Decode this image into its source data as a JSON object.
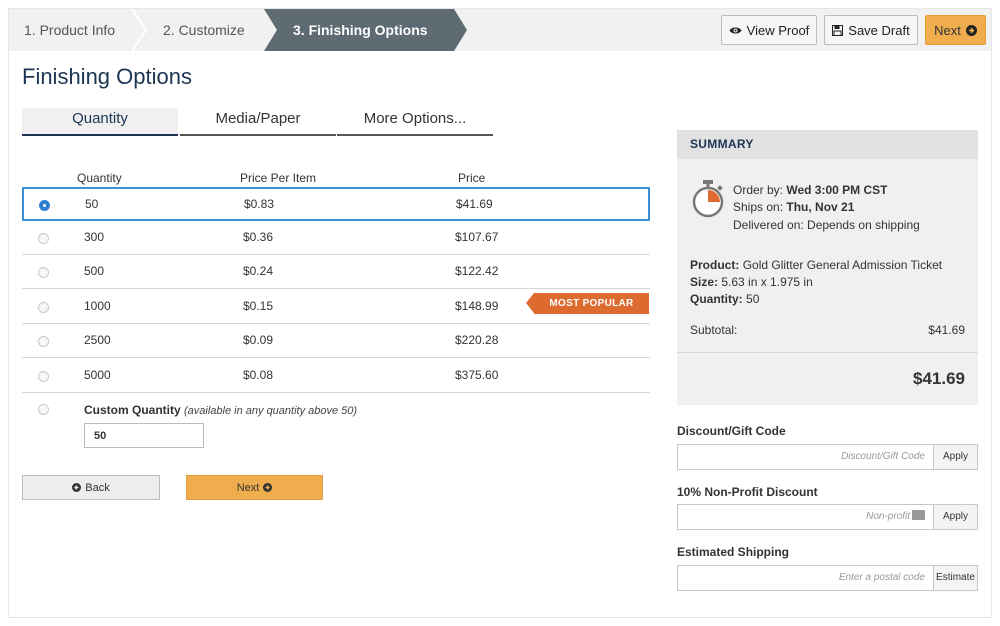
{
  "steps": [
    {
      "label": "1. Product Info"
    },
    {
      "label": "2. Customize"
    },
    {
      "label": "3. Finishing Options"
    }
  ],
  "toolbar": {
    "view_proof": "View Proof",
    "save_draft": "Save Draft",
    "next": "Next"
  },
  "page_title": "Finishing Options",
  "tabs": [
    {
      "label": "Quantity",
      "active": true
    },
    {
      "label": "Media/Paper",
      "active": false
    },
    {
      "label": "More Options...",
      "active": false
    }
  ],
  "table": {
    "headers": {
      "qty": "Quantity",
      "ppi": "Price Per Item",
      "price": "Price"
    },
    "rows": [
      {
        "qty": "50",
        "ppi": "$0.83",
        "price": "$41.69",
        "selected": true
      },
      {
        "qty": "300",
        "ppi": "$0.36",
        "price": "$107.67"
      },
      {
        "qty": "500",
        "ppi": "$0.24",
        "price": "$122.42"
      },
      {
        "qty": "1000",
        "ppi": "$0.15",
        "price": "$148.99",
        "badge": "MOST POPULAR"
      },
      {
        "qty": "2500",
        "ppi": "$0.09",
        "price": "$220.28"
      },
      {
        "qty": "5000",
        "ppi": "$0.08",
        "price": "$375.60"
      }
    ]
  },
  "custom_quantity": {
    "label": "Custom Quantity",
    "note": "(available in any quantity above 50)",
    "value": "50"
  },
  "buttons": {
    "back": "Back",
    "next": "Next"
  },
  "summary": {
    "heading": "SUMMARY",
    "order_by_label": "Order by: ",
    "order_by": "Wed 3:00 PM CST",
    "ships_on_label": "Ships on: ",
    "ships_on": "Thu, Nov 21",
    "delivered_on": "Delivered on: Depends on shipping",
    "product_label": "Product:",
    "product": "Gold Glitter General Admission Ticket",
    "size_label": "Size:",
    "size": "5.63 in x 1.975 in",
    "quantity_label": "Quantity:",
    "quantity": "50",
    "subtotal_label": "Subtotal:",
    "subtotal": "$41.69",
    "total": "$41.69"
  },
  "discount": {
    "label": "Discount/Gift Code",
    "placeholder": "Discount/Gift Code",
    "button": "Apply"
  },
  "nonprofit": {
    "label": "10% Non-Profit Discount",
    "placeholder": "Non-profit",
    "button": "Apply"
  },
  "shipping": {
    "label": "Estimated Shipping",
    "placeholder": "Enter a postal code",
    "button": "Estimate"
  },
  "colors": {
    "accent": "#f0ad4e",
    "active_step": "#5f6b72",
    "badge": "#dd6a2e",
    "title": "#1c3553",
    "selected_border": "#3b8fd6"
  }
}
